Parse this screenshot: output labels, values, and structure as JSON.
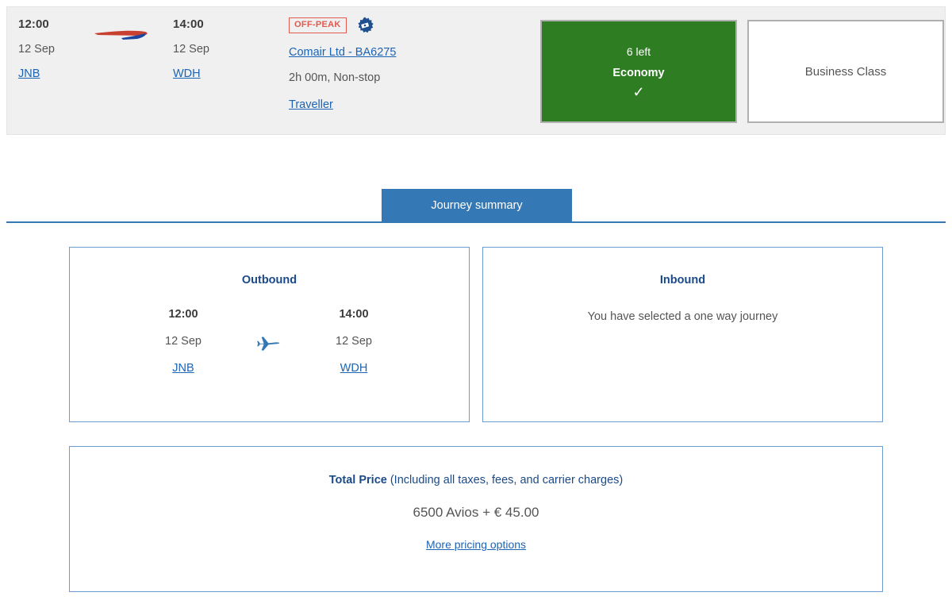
{
  "flight_strip": {
    "departure": {
      "time": "12:00",
      "date": "12 Sep",
      "airport_code": "JNB"
    },
    "arrival": {
      "time": "14:00",
      "date": "12 Sep",
      "airport_code": "WDH"
    },
    "airline_logo": "british-airways-speedmarque",
    "fare_badge": "OFF-PEAK",
    "avios_badge_icon": "avios-reward-icon",
    "flight_number_link": "Comair Ltd - BA6275",
    "duration": "2h 00m, Non-stop",
    "cabin_link": "Traveller",
    "cabins": [
      {
        "seats_left": "6 left",
        "name": "Economy",
        "selected": true,
        "check_icon": "✓",
        "bg_color": "#2e7d23"
      },
      {
        "seats_left": "",
        "name": "Business Class",
        "selected": false,
        "check_icon": "",
        "bg_color": "#ffffff"
      }
    ]
  },
  "tabs": {
    "active_label": "Journey summary",
    "accent_color": "#3478b5"
  },
  "summary": {
    "outbound": {
      "title": "Outbound",
      "depart_time": "12:00",
      "depart_date": "12 Sep",
      "depart_airport": "JNB",
      "arrive_time": "14:00",
      "arrive_date": "12 Sep",
      "arrive_airport": "WDH",
      "plane_icon": "airplane-icon"
    },
    "inbound": {
      "title": "Inbound",
      "message": "You have selected a one way journey"
    },
    "price": {
      "heading_bold": "Total Price",
      "heading_rest": " (Including all taxes, fees, and carrier charges)",
      "amount": "6500 Avios + € 45.00",
      "more_options_link": "More pricing options"
    }
  }
}
